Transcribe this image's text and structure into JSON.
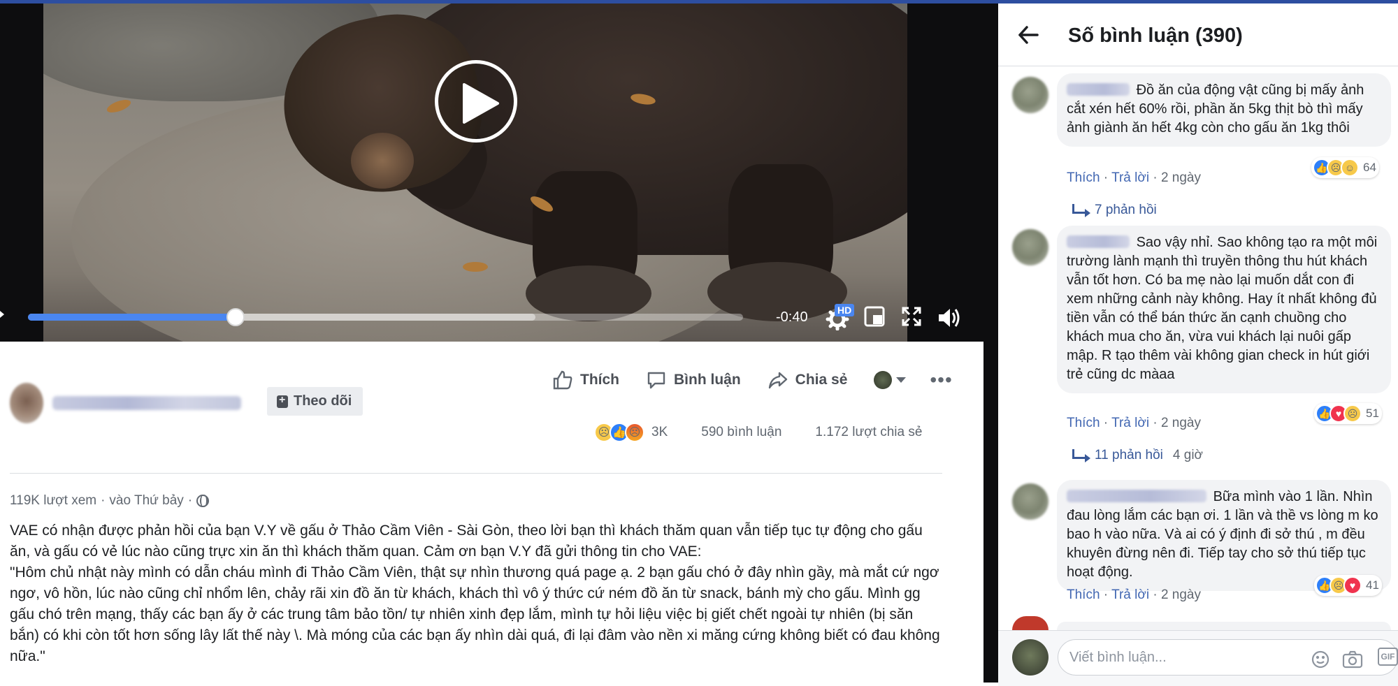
{
  "video": {
    "time_remaining": "-0:40",
    "progress": {
      "played_fraction": 0.29,
      "buffered_fraction": 0.71
    },
    "hd_label": "HD",
    "accent": "#4a86f0"
  },
  "post": {
    "follow_label": "Theo dõi",
    "actions": {
      "like": "Thích",
      "comment": "Bình luận",
      "share": "Chia sẻ"
    },
    "stats": {
      "reactions_count": "3K",
      "comments": "590 bình luận",
      "shares": "1.172 lượt chia sẻ"
    },
    "meta": {
      "views": "119K lượt xem",
      "date": "vào Thứ bảy"
    },
    "body_paragraphs": [
      "VAE có nhận được phản hồi của bạn V.Y về gấu ở Thảo Cầm Viên - Sài Gòn, theo lời bạn thì khách thăm quan vẫn tiếp tục tự động cho gấu ăn, và gấu có vẻ lúc nào cũng trực xin ăn thì khách thăm quan. Cảm ơn bạn V.Y đã gửi thông tin cho VAE:",
      "\"Hôm chủ nhật này mình có dẫn cháu mình đi Thảo Cầm Viên, thật sự nhìn thương quá page ạ. 2 bạn gấu chó ở đây nhìn gầy, mà mắt cứ ngơ ngơ, vô hồn, lúc nào cũng chỉ nhổm lên, chảy rãi xin đồ ăn từ khách, khách thì vô ý thức cứ ném đồ ăn từ snack, bánh mỳ cho gấu. Mình gg gấu chó trên mạng, thấy các bạn ấy ở các trung tâm bảo tồn/ tự nhiên xinh đẹp lắm, mình tự hỏi liệu việc bị giết chết ngoài tự nhiên (bị săn bắn) có khi còn tốt hơn sống lây lất thế này \\. Mà móng của các bạn ấy nhìn dài quá, đi lại đâm vào nền xi măng cứng không biết có đau không nữa.\""
    ]
  },
  "comments_panel": {
    "title": "Số bình luận (390)",
    "comments": [
      {
        "text": "Đồ ăn của động vật cũng bị mấy ảnh cắt xén hết 60% rồi, phần ăn 5kg thịt bò thì mấy ảnh giành ăn hết 4kg còn cho gấu ăn 1kg thôi",
        "reaction_count": "64",
        "like": "Thích",
        "reply": "Trả lời",
        "age": "2 ngày",
        "replies": "7 phản hồi",
        "replies_age": ""
      },
      {
        "text": "Sao vậy nhỉ. Sao không tạo ra một môi trường lành mạnh thì truyền thông thu hút khách vẫn tốt hơn. Có ba mẹ nào lại muốn dắt con đi xem những cảnh này không. Hay ít nhất không đủ tiền vẫn có thể bán thức ăn cạnh chuồng cho khách mua cho ăn, vừa vui khách lại nuôi gấp mập. R tạo thêm vài không gian check in hút giới trẻ cũng dc màaa",
        "reaction_count": "51",
        "like": "Thích",
        "reply": "Trả lời",
        "age": "2 ngày",
        "replies": "11 phản hồi",
        "replies_age": "4 giờ"
      },
      {
        "text": "Bữa mình vào 1 lần. Nhìn đau lòng lắm các bạn ơi. 1 lần và thề vs lòng m ko bao h vào nữa. Và ai có ý định đi sở thú , m đều khuyên đừng nên đi. Tiếp tay cho sở thú tiếp tục hoạt động.",
        "reaction_count": "41",
        "like": "Thích",
        "reply": "Trả lời",
        "age": "2 ngày"
      }
    ],
    "composer_placeholder": "Viết bình luận...",
    "gif_label": "GIF"
  }
}
